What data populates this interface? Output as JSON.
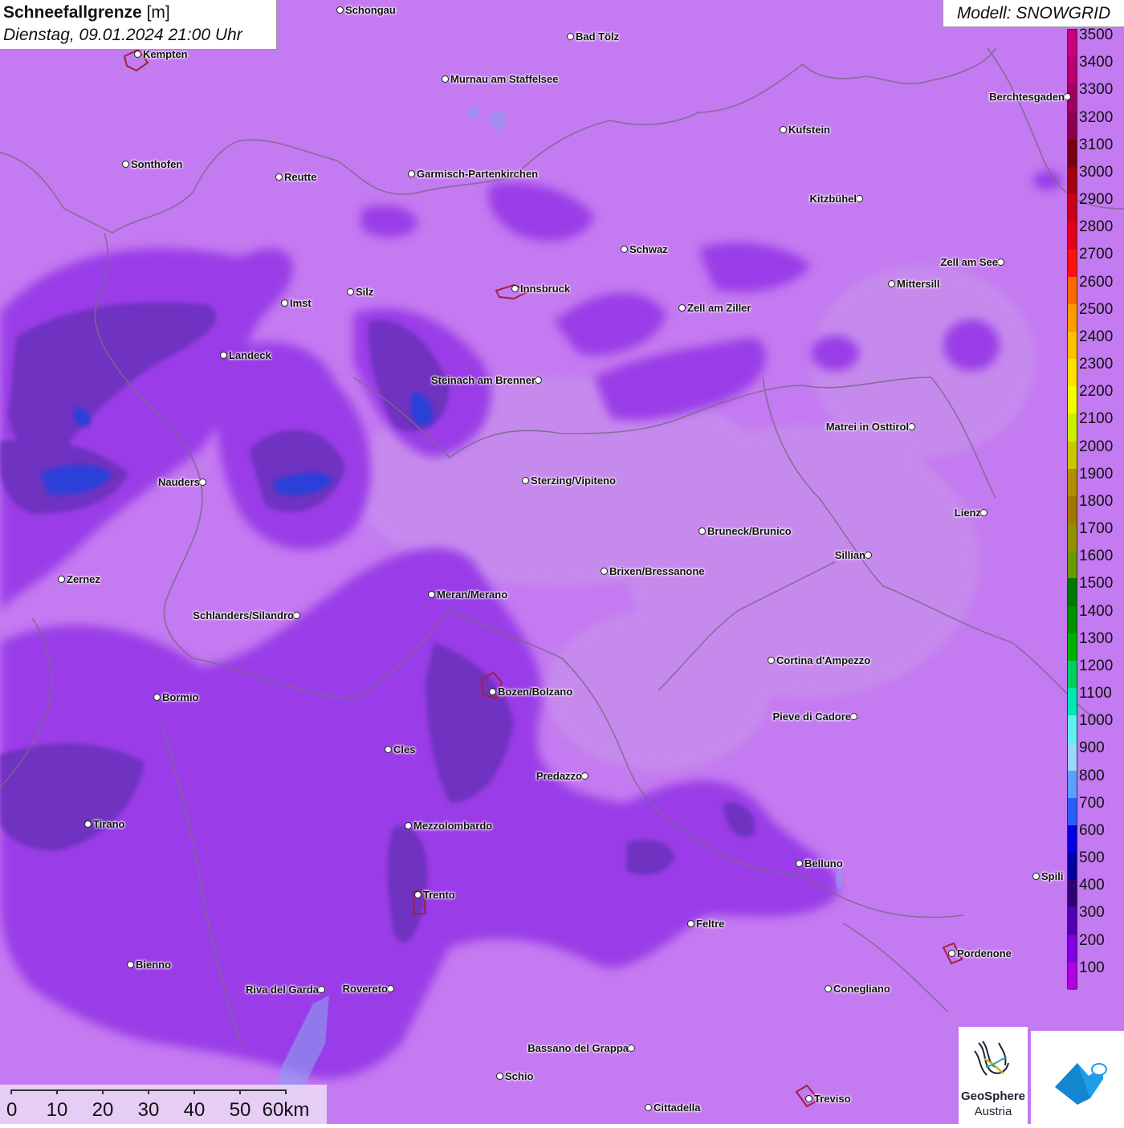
{
  "title": {
    "main_bold": "Schneefallgrenze",
    "main_unit": "[m]",
    "datetime": "Dienstag, 09.01.2024 21:00 Uhr"
  },
  "model": {
    "label": "Modell: SNOWGRID"
  },
  "legend": {
    "labels": [
      "3500",
      "3400",
      "3300",
      "3200",
      "3100",
      "3000",
      "2900",
      "2800",
      "2700",
      "2600",
      "2500",
      "2400",
      "2300",
      "2200",
      "2100",
      "2000",
      "1900",
      "1800",
      "1700",
      "1600",
      "1500",
      "1400",
      "1300",
      "1200",
      "1100",
      "1000",
      "900",
      "800",
      "700",
      "600",
      "500",
      "400",
      "300",
      "200",
      "100"
    ],
    "colors": [
      "#c8007a",
      "#b8006e",
      "#a00060",
      "#8c0050",
      "#780010",
      "#a00010",
      "#c80018",
      "#e0001e",
      "#ff1010",
      "#ff6a00",
      "#ff9a00",
      "#ffc000",
      "#ffe000",
      "#f0ff00",
      "#c8f000",
      "#c8c800",
      "#b09000",
      "#a07800",
      "#909000",
      "#6a9a00",
      "#007800",
      "#009000",
      "#00b000",
      "#00d060",
      "#00e8b0",
      "#60f0f0",
      "#9ad8ff",
      "#5aa0ff",
      "#2860ff",
      "#0000e0",
      "#0000a0",
      "#300078",
      "#5000b0",
      "#8000e0",
      "#b000e0"
    ],
    "bottom_color": "#c47af0"
  },
  "cities": [
    {
      "name": "Schongau",
      "label_side": "right"
    },
    {
      "name": "Kempten",
      "label_side": "right"
    },
    {
      "name": "Bad Tölz",
      "label_side": "right"
    },
    {
      "name": "Murnau am Staffelsee",
      "label_side": "right"
    },
    {
      "name": "Berchtesgaden",
      "label_side": "left"
    },
    {
      "name": "Kufstein",
      "label_side": "right"
    },
    {
      "name": "Sonthofen",
      "label_side": "right"
    },
    {
      "name": "Reutte",
      "label_side": "right"
    },
    {
      "name": "Garmisch-Partenkirchen",
      "label_side": "right"
    },
    {
      "name": "Kitzbühel",
      "label_side": "left"
    },
    {
      "name": "Schwaz",
      "label_side": "right"
    },
    {
      "name": "Zell am See",
      "label_side": "left"
    },
    {
      "name": "Mittersill",
      "label_side": "right"
    },
    {
      "name": "Innsbruck",
      "label_side": "right"
    },
    {
      "name": "Silz",
      "label_side": "right"
    },
    {
      "name": "Imst",
      "label_side": "right"
    },
    {
      "name": "Zell am Ziller",
      "label_side": "right"
    },
    {
      "name": "Landeck",
      "label_side": "right"
    },
    {
      "name": "Steinach am Brenner",
      "label_side": "left"
    },
    {
      "name": "Matrei in Osttirol",
      "label_side": "left"
    },
    {
      "name": "Nauders",
      "label_side": "left"
    },
    {
      "name": "Sterzing/Vipiteno",
      "label_side": "right"
    },
    {
      "name": "Lienz",
      "label_side": "left"
    },
    {
      "name": "Bruneck/Brunico",
      "label_side": "right"
    },
    {
      "name": "Sillian",
      "label_side": "left"
    },
    {
      "name": "Zernez",
      "label_side": "right"
    },
    {
      "name": "Brixen/Bressanone",
      "label_side": "right"
    },
    {
      "name": "Meran/Merano",
      "label_side": "right"
    },
    {
      "name": "Schlanders/Silandro",
      "label_side": "left"
    },
    {
      "name": "Cortina d'Ampezzo",
      "label_side": "right"
    },
    {
      "name": "Bormio",
      "label_side": "right"
    },
    {
      "name": "Bozen/Bolzano",
      "label_side": "right"
    },
    {
      "name": "Pieve di Cadore",
      "label_side": "left"
    },
    {
      "name": "Cles",
      "label_side": "right"
    },
    {
      "name": "Predazzo",
      "label_side": "left"
    },
    {
      "name": "Tirano",
      "label_side": "right"
    },
    {
      "name": "Mezzolombardo",
      "label_side": "right"
    },
    {
      "name": "Belluno",
      "label_side": "right"
    },
    {
      "name": "Spili",
      "label_side": "right"
    },
    {
      "name": "Trento",
      "label_side": "right"
    },
    {
      "name": "Feltre",
      "label_side": "right"
    },
    {
      "name": "Pordenone",
      "label_side": "right"
    },
    {
      "name": "Bienno",
      "label_side": "right"
    },
    {
      "name": "Riva del Garda",
      "label_side": "left"
    },
    {
      "name": "Rovereto",
      "label_side": "left"
    },
    {
      "name": "Conegliano",
      "label_side": "right"
    },
    {
      "name": "Bassano del Grappa",
      "label_side": "left"
    },
    {
      "name": "Schio",
      "label_side": "right"
    },
    {
      "name": "Treviso",
      "label_side": "right"
    },
    {
      "name": "Cittadella",
      "label_side": "right"
    }
  ],
  "scalebar": {
    "labels": [
      "0",
      "10",
      "20",
      "30",
      "40",
      "50",
      "60km"
    ]
  },
  "logos": {
    "geosphere_line1": "GeoSphere",
    "geosphere_line2": "Austria"
  }
}
